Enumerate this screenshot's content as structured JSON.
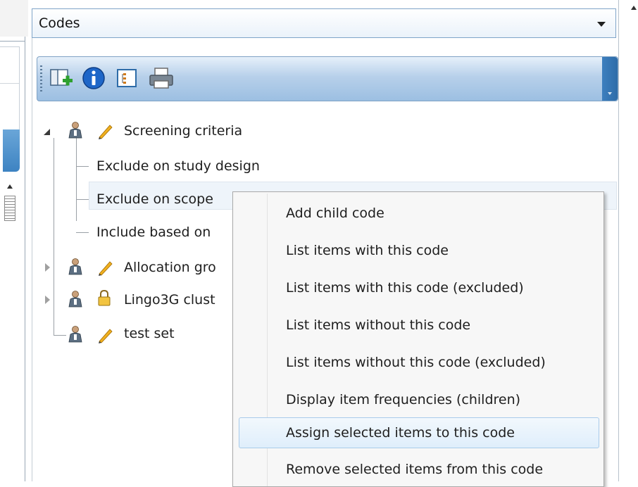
{
  "panel": {
    "dropdown_label": "Codes"
  },
  "toolbar": {
    "buttons": [
      {
        "name": "add-code-set-icon"
      },
      {
        "name": "info-icon"
      },
      {
        "name": "tree-view-icon"
      },
      {
        "name": "print-icon"
      }
    ]
  },
  "tree": {
    "root": {
      "label": "Screening criteria",
      "children": [
        {
          "label": "Exclude on study design"
        },
        {
          "label": "Exclude on scope"
        },
        {
          "label": "Include based on"
        }
      ]
    },
    "others": [
      {
        "label": "Allocation gro"
      },
      {
        "label": "Lingo3G clust"
      },
      {
        "label": "test set"
      }
    ]
  },
  "context_menu": {
    "items": [
      {
        "label": "Add child code"
      },
      {
        "label": "List items with this code"
      },
      {
        "label": "List items with this code (excluded)"
      },
      {
        "label": "List items without this code"
      },
      {
        "label": "List items without this code (excluded)"
      },
      {
        "label": "Display item frequencies (children)"
      },
      {
        "label": "Assign selected items to this code"
      },
      {
        "label": "Remove selected items from this code"
      }
    ],
    "highlighted_index": 6
  },
  "colors": {
    "toolbar_blue": "#9cbfe2",
    "highlight_border": "#a9cbea",
    "menu_background": "#f7f7f7"
  }
}
